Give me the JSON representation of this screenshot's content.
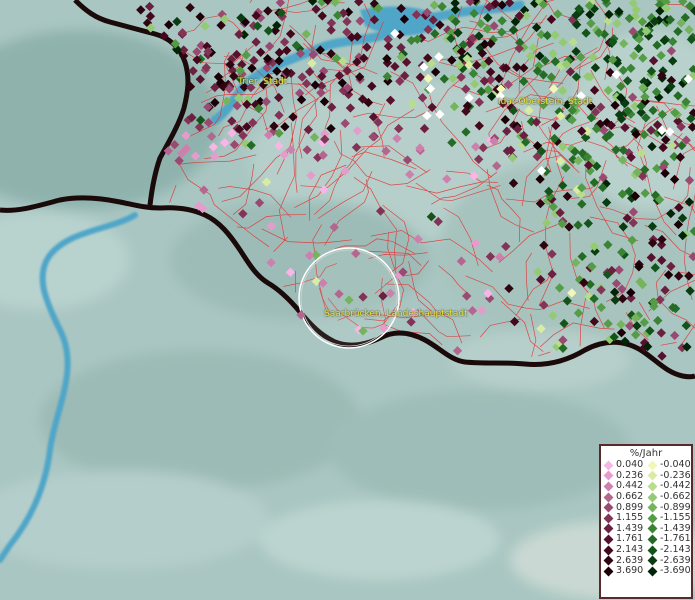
{
  "places": [
    {
      "id": "trier",
      "label": "Trier, Stadt"
    },
    {
      "id": "idar",
      "label": "Idar-Oberstein, Stadt"
    },
    {
      "id": "saarbruecken",
      "label": "Saarbrücken, Landeshauptstadt"
    }
  ],
  "legend": {
    "title": "%/Jahr",
    "positive": [
      {
        "value": "0.040",
        "color": "#f7b6e6"
      },
      {
        "value": "0.236",
        "color": "#e59ccd"
      },
      {
        "value": "0.442",
        "color": "#cd80ad"
      },
      {
        "value": "0.662",
        "color": "#b4668f"
      },
      {
        "value": "0.899",
        "color": "#9a4a70"
      },
      {
        "value": "1.155",
        "color": "#833456"
      },
      {
        "value": "1.439",
        "color": "#6c2040"
      },
      {
        "value": "1.761",
        "color": "#57112c"
      },
      {
        "value": "2.143",
        "color": "#43081c"
      },
      {
        "value": "2.639",
        "color": "#2e0410"
      },
      {
        "value": "3.690",
        "color": "#1a0006"
      }
    ],
    "negative": [
      {
        "value": "-0.040",
        "color": "#f2f7b8"
      },
      {
        "value": "-0.236",
        "color": "#d8eca2"
      },
      {
        "value": "-0.442",
        "color": "#b8dd8c"
      },
      {
        "value": "-0.662",
        "color": "#95ca74"
      },
      {
        "value": "-0.899",
        "color": "#74b45c"
      },
      {
        "value": "-1.155",
        "color": "#559c46"
      },
      {
        "value": "-1.439",
        "color": "#3a8434"
      },
      {
        "value": "-1.761",
        "color": "#246c26"
      },
      {
        "value": "-2.143",
        "color": "#13541a"
      },
      {
        "value": "-2.639",
        "color": "#093c10"
      },
      {
        "value": "-3.690",
        "color": "#022406"
      }
    ]
  },
  "colors": {
    "terrain": "#a9c6c2",
    "river": "#4fa6c8",
    "state_border": "#1a0a0a",
    "municipal_border": "#e03030"
  }
}
